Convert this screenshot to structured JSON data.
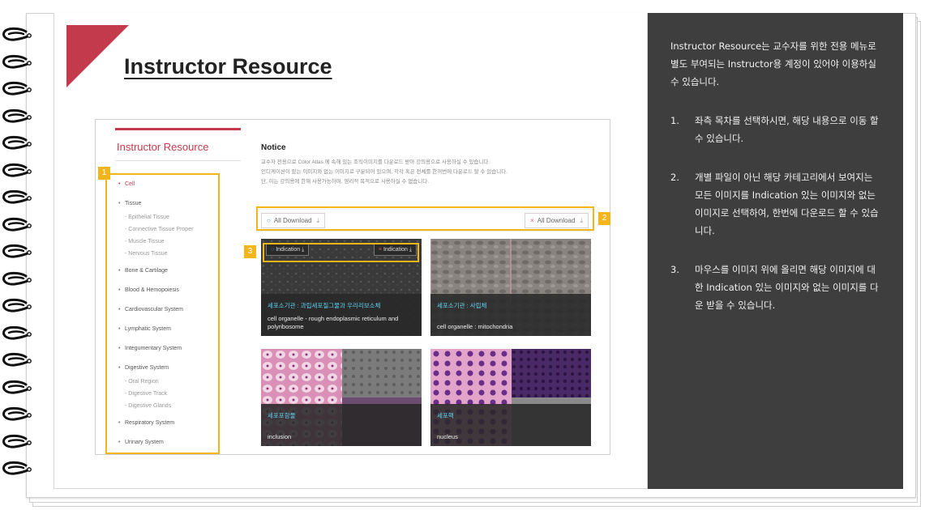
{
  "page": {
    "title": "Instructor Resource"
  },
  "screenshot": {
    "sidebar": {
      "title": "Instructor Resource",
      "items": [
        {
          "label": "Cell",
          "active": true,
          "sub": []
        },
        {
          "label": "Tissue",
          "active": false,
          "sub": [
            "- Epithelial Tissue",
            "- Connective Tissue Proper",
            "- Muscle Tissue",
            "- Nervous Tissue"
          ]
        },
        {
          "label": "Bone & Cartilage",
          "active": false,
          "sub": []
        },
        {
          "label": "Blood & Hemopoiesis",
          "active": false,
          "sub": []
        },
        {
          "label": "Cardiovascular System",
          "active": false,
          "sub": []
        },
        {
          "label": "Lymphatic System",
          "active": false,
          "sub": []
        },
        {
          "label": "Integumentary System",
          "active": false,
          "sub": []
        },
        {
          "label": "Digestive System",
          "active": false,
          "sub": [
            "- Oral Region",
            "- Digestive Track",
            "- Digestive Glands"
          ]
        },
        {
          "label": "Respiratory System",
          "active": false,
          "sub": []
        },
        {
          "label": "Urinary System",
          "active": false,
          "sub": []
        }
      ]
    },
    "notice": {
      "title": "Notice",
      "lines": [
        "교수자 전용으로 Color Atlas 에 속해 있는 조직이미지를 다운로드 받아 강의용으로 사용하실 수 있습니다.",
        "인디케이션이 있는 이미지와 없는 이미지로 구분되어 있으며, 각각 혹은 전체를 한꺼번에 다운로드 할 수 있습니다.",
        "단, 이는 강의용에 한해 사용가능하며, 영리적 목적으로 사용하실 수 없습니다."
      ]
    },
    "download": {
      "with_indication": "All Download",
      "without_indication": "All Download",
      "icon_with": "circle-icon",
      "icon_without": "x-icon"
    },
    "indication_buttons": {
      "with": "Indication",
      "without": "Indication"
    },
    "tiles": [
      {
        "ko": "세포소기관 : 과립세포질그물과 우리리보소체",
        "en": "cell organelle - rough endoplasmic reticulum and polyribosome"
      },
      {
        "ko": "세포소기관 : 사립체",
        "en": "cell organelle : mitochondria"
      },
      {
        "ko": "세포포함물",
        "en": "inclusion"
      },
      {
        "ko": "세포핵",
        "en": "nucleus"
      }
    ]
  },
  "callouts": [
    "1",
    "2",
    "3"
  ],
  "panel": {
    "intro": "Instructor Resource는 교수자를 위한 전용 메뉴로 별도 부여되는 Instructor용 계정이 있어야 이용하실 수 있습니다.",
    "items": [
      {
        "num": "1.",
        "text": "좌측 목차를 선택하시면, 해당 내용으로 이동 할 수 있습니다."
      },
      {
        "num": "2.",
        "text": "개별 파일이 아닌 해당 카테고리에서 보여지는 모든 이미지를 Indication 있는 이미지와 없는 이미지로 선택하여, 한번에 다운로드 할 수 있습니다."
      },
      {
        "num": "3.",
        "text": "마우스를 이미지 위에 올리면 해당 이미지에 대한 Indication 있는 이미지와 없는 이미지를 다운 받을 수 있습니다."
      }
    ]
  },
  "colors": {
    "accent": "#c43a4d",
    "callout": "#f2b51c",
    "panel": "#3e3e3e",
    "caption_ko": "#5ed2f0"
  }
}
